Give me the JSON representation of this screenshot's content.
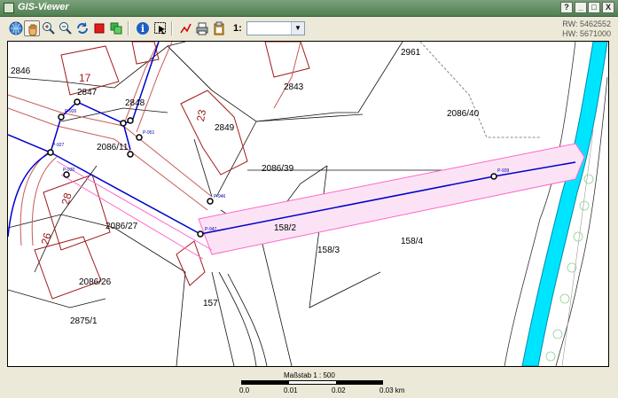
{
  "window": {
    "title": "GIS-Viewer",
    "controls": [
      "?",
      "_",
      "□",
      "X"
    ]
  },
  "toolbar": {
    "scale_prefix": "1:",
    "scale_value": ""
  },
  "coordinates": {
    "rw": "RW: 5462552",
    "hw": "HW: 5671000"
  },
  "map": {
    "parcels": [
      "2846",
      "2847",
      "2848",
      "2849",
      "2843",
      "2961",
      "2086/40",
      "2086/11",
      "2086/39",
      "2086/27",
      "158/2",
      "158/3",
      "158/4",
      "2086/26",
      "157",
      "2875/1"
    ],
    "house_numbers": [
      "17",
      "23",
      "28",
      "26"
    ],
    "point_labels": [
      "P-939",
      "P-947",
      "P-927",
      "P-926",
      "P-946",
      "P-951",
      "P-930"
    ]
  },
  "footer": {
    "scale_title": "Maßstab 1 : 500",
    "ticks": [
      "0.0",
      "0.01",
      "0.02",
      "0.03 km"
    ]
  },
  "colors": {
    "titlebar": "#5d8a5e",
    "water": "#00e5ff",
    "line_blue": "#0000cc",
    "line_red": "#cc3333",
    "corridor": "#ff66cc"
  }
}
